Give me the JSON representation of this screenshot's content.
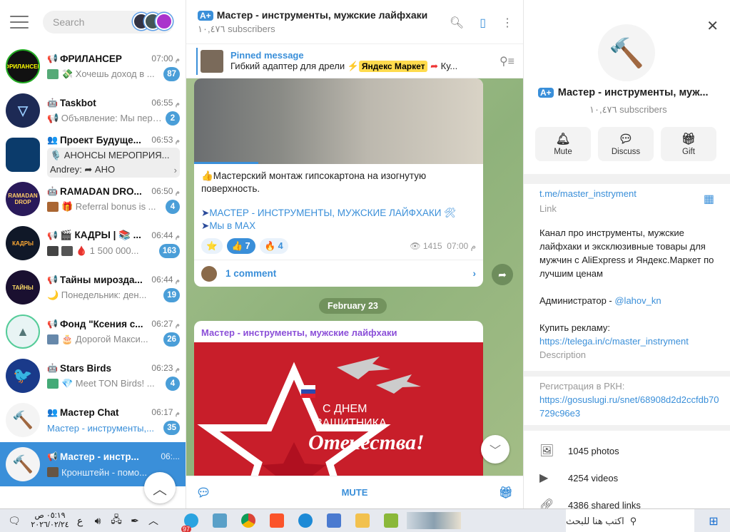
{
  "sidebar": {
    "search_placeholder": "Search",
    "chats": [
      {
        "name": "ФРИЛАНСЕР",
        "time": "07:00",
        "ampm": "م",
        "preview": "💸 Хочешь доход в ...",
        "badge": "87",
        "avatar_color": "#111",
        "avatar_text": "ФРИЛАНСЕР"
      },
      {
        "name": "Taskbot",
        "time": "06:55",
        "ampm": "م",
        "preview": "📢 Объявление: Мы пере...",
        "badge": "2",
        "avatar_color": "#1d2a55",
        "avatar_text": ""
      },
      {
        "name": "Проект Будуще...",
        "time": "06:53",
        "ampm": "م",
        "preview": "🎙️ АНОНСЫ МЕРОПРИЯ...",
        "preview2": "Andrey: ➦ АНО",
        "badge": "",
        "avatar_color": "#0b3b6b",
        "avatar_text": ""
      },
      {
        "name": "RAMADAN DRO...",
        "time": "06:50",
        "ampm": "م",
        "preview": "🎁 Referral bonus is ...",
        "badge": "4",
        "avatar_color": "#2a1a5a",
        "avatar_text": "RAMADAN DROP"
      },
      {
        "name": "🎬 КАДРЫ | 📚 ...",
        "time": "06:44",
        "ampm": "م",
        "preview": "🩸 1 500 000...",
        "badge": "163",
        "avatar_color": "#101828",
        "avatar_text": "КАДРЫ"
      },
      {
        "name": "Тайны мирозда...",
        "time": "06:44",
        "ampm": "م",
        "preview": "🌙 Понедельник: ден...",
        "badge": "19",
        "avatar_color": "#1a1030",
        "avatar_text": "ТАЙНЫ"
      },
      {
        "name": "Фонд \"Ксения с...",
        "time": "06:27",
        "ampm": "م",
        "preview": "🎂 Дорогой Макси...",
        "badge": "26",
        "avatar_color": "#e8f4f4",
        "avatar_text": ""
      },
      {
        "name": "Stars Birds",
        "time": "06:23",
        "ampm": "م",
        "preview": "💎 Meet TON Birds! ...",
        "badge": "4",
        "avatar_color": "#1a3a8a",
        "avatar_text": ""
      },
      {
        "name": "Мастер Chat",
        "time": "06:17",
        "ampm": "م",
        "preview": "Мастер - инструменты,...",
        "badge": "35",
        "avatar_color": "#f4f4f4",
        "avatar_text": ""
      },
      {
        "name": "Мастер - инстр...",
        "time": "06:...",
        "ampm": "م",
        "preview": "Кронштейн - помо...",
        "badge": "",
        "avatar_color": "#f4f4f4",
        "avatar_text": ""
      }
    ]
  },
  "channel": {
    "title": "Мастер - инструменты, мужские лайфхаки",
    "subscribers": "١٠,٤٧٦ subscribers",
    "pinned_title": "Pinned message",
    "pinned_text": "Гибкий адаптер для дрели",
    "pinned_tag": "Яндекс Маркет",
    "pinned_tail": "Ку..."
  },
  "post1": {
    "text": "👍Мастерский монтаж гипсокартона на изогнутую поверхность.",
    "link1": "МАСТЕР - ИНСТРУМЕНТЫ, МУЖСКИЕ ЛАЙФХАКИ 🛠",
    "link2": "Мы в MAX",
    "reactions": [
      {
        "emoji": "⭐",
        "count": ""
      },
      {
        "emoji": "👍",
        "count": "7"
      },
      {
        "emoji": "🔥",
        "count": "4"
      }
    ],
    "views": "1415",
    "time": "07:00 م",
    "comments": "1 comment"
  },
  "date_separator": "February 23",
  "post2": {
    "author": "Мастер - инструменты, мужские лайфхаки",
    "poster_line1": "С ДНЕМ",
    "poster_line2": "ЗАЩИТНИКА",
    "poster_line3": "Отечества!"
  },
  "mute_label": "MUTE",
  "info": {
    "name": "Мастер - инструменты, муж...",
    "subscribers": "١٠,٤٧٦ subscribers",
    "buttons": {
      "mute": "Mute",
      "discuss": "Discuss",
      "gift": "Gift"
    },
    "link": "t.me/master_instryment",
    "link_label": "Link",
    "desc1": "Канал про инструменты, мужские лайфхаки и эксклюзивные товары для мужчин с AliExpress и Яндекс.Маркет по лучшим ценам",
    "admin_prefix": "Администратор - ",
    "admin": "@lahov_kn",
    "ads": "Купить рекламу:",
    "ads_link": "https://telega.in/c/master_instryment",
    "desc_label": "Description",
    "rkn": "Регистрация в РКН:",
    "rkn_link": "https://gosuslugi.ru/snet/68908d2d2ccfdb70729c96e3",
    "photos": "1045 photos",
    "videos": "4254 videos",
    "links": "4386 shared links"
  },
  "taskbar": {
    "search": "اكتب هنا للبحث",
    "time": "٠٥:١٩ ص",
    "date": "٢٠٢٦/٠٢/٢٤",
    "lang": "ع",
    "telegram_badge": "97"
  }
}
